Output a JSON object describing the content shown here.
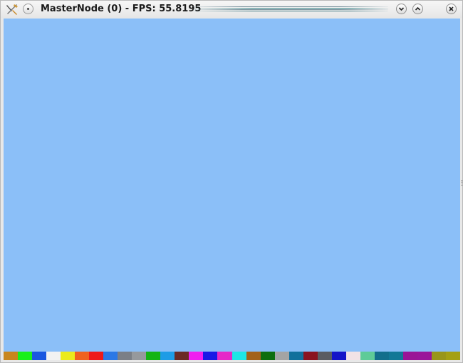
{
  "window": {
    "title": "MasterNode (0) - FPS: 55.8195",
    "viewport_color": "#8bbff8"
  },
  "titlebar_buttons": {
    "menu": "window-menu-icon",
    "minimize": "chevron-down-icon",
    "maximize": "chevron-up-icon",
    "close": "close-icon"
  },
  "palette": {
    "colors": [
      "#c8861e",
      "#19f019",
      "#1a57e0",
      "#f2f2f2",
      "#ebeb1a",
      "#f0621e",
      "#ee1a1a",
      "#2a78e6",
      "#7b7f86",
      "#96999d",
      "#14b414",
      "#1e9ce6",
      "#6b2a24",
      "#f01ef0",
      "#1919e6",
      "#e628c8",
      "#1ee6e6",
      "#a3621a",
      "#0d6e0d",
      "#a4a4a4",
      "#11709c",
      "#8a1320",
      "#5a5c62",
      "#1414c8",
      "#f2e2e6",
      "#5ecb98",
      "#126e8c",
      "#127896",
      "#9a1496",
      "#9a149a",
      "#99961a",
      "#a4a014"
    ]
  }
}
